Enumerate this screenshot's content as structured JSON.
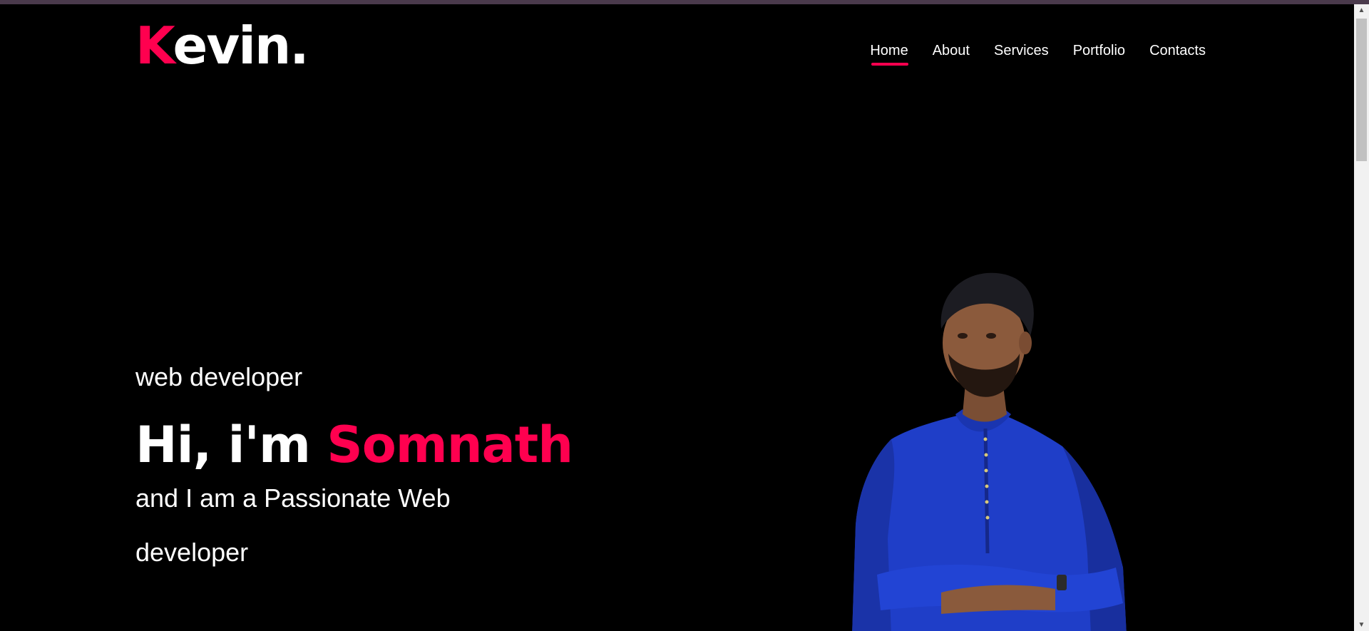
{
  "logo": {
    "initial": "K",
    "rest": "evin."
  },
  "nav": {
    "items": [
      {
        "label": "Home"
      },
      {
        "label": "About"
      },
      {
        "label": "Services"
      },
      {
        "label": "Portfolio"
      },
      {
        "label": "Contacts"
      }
    ],
    "active": "Home"
  },
  "hero": {
    "role": "web developer",
    "greeting": "Hi, i'm",
    "name": "Somnath",
    "tagline": "and I am a Passionate Web developer"
  },
  "colors": {
    "accent": "#ff004f",
    "background": "#000000",
    "text": "#ffffff",
    "shirt": "#1f3ec8"
  },
  "icons": {
    "scroll_up": "triangle-up",
    "scroll_down": "triangle-down"
  }
}
